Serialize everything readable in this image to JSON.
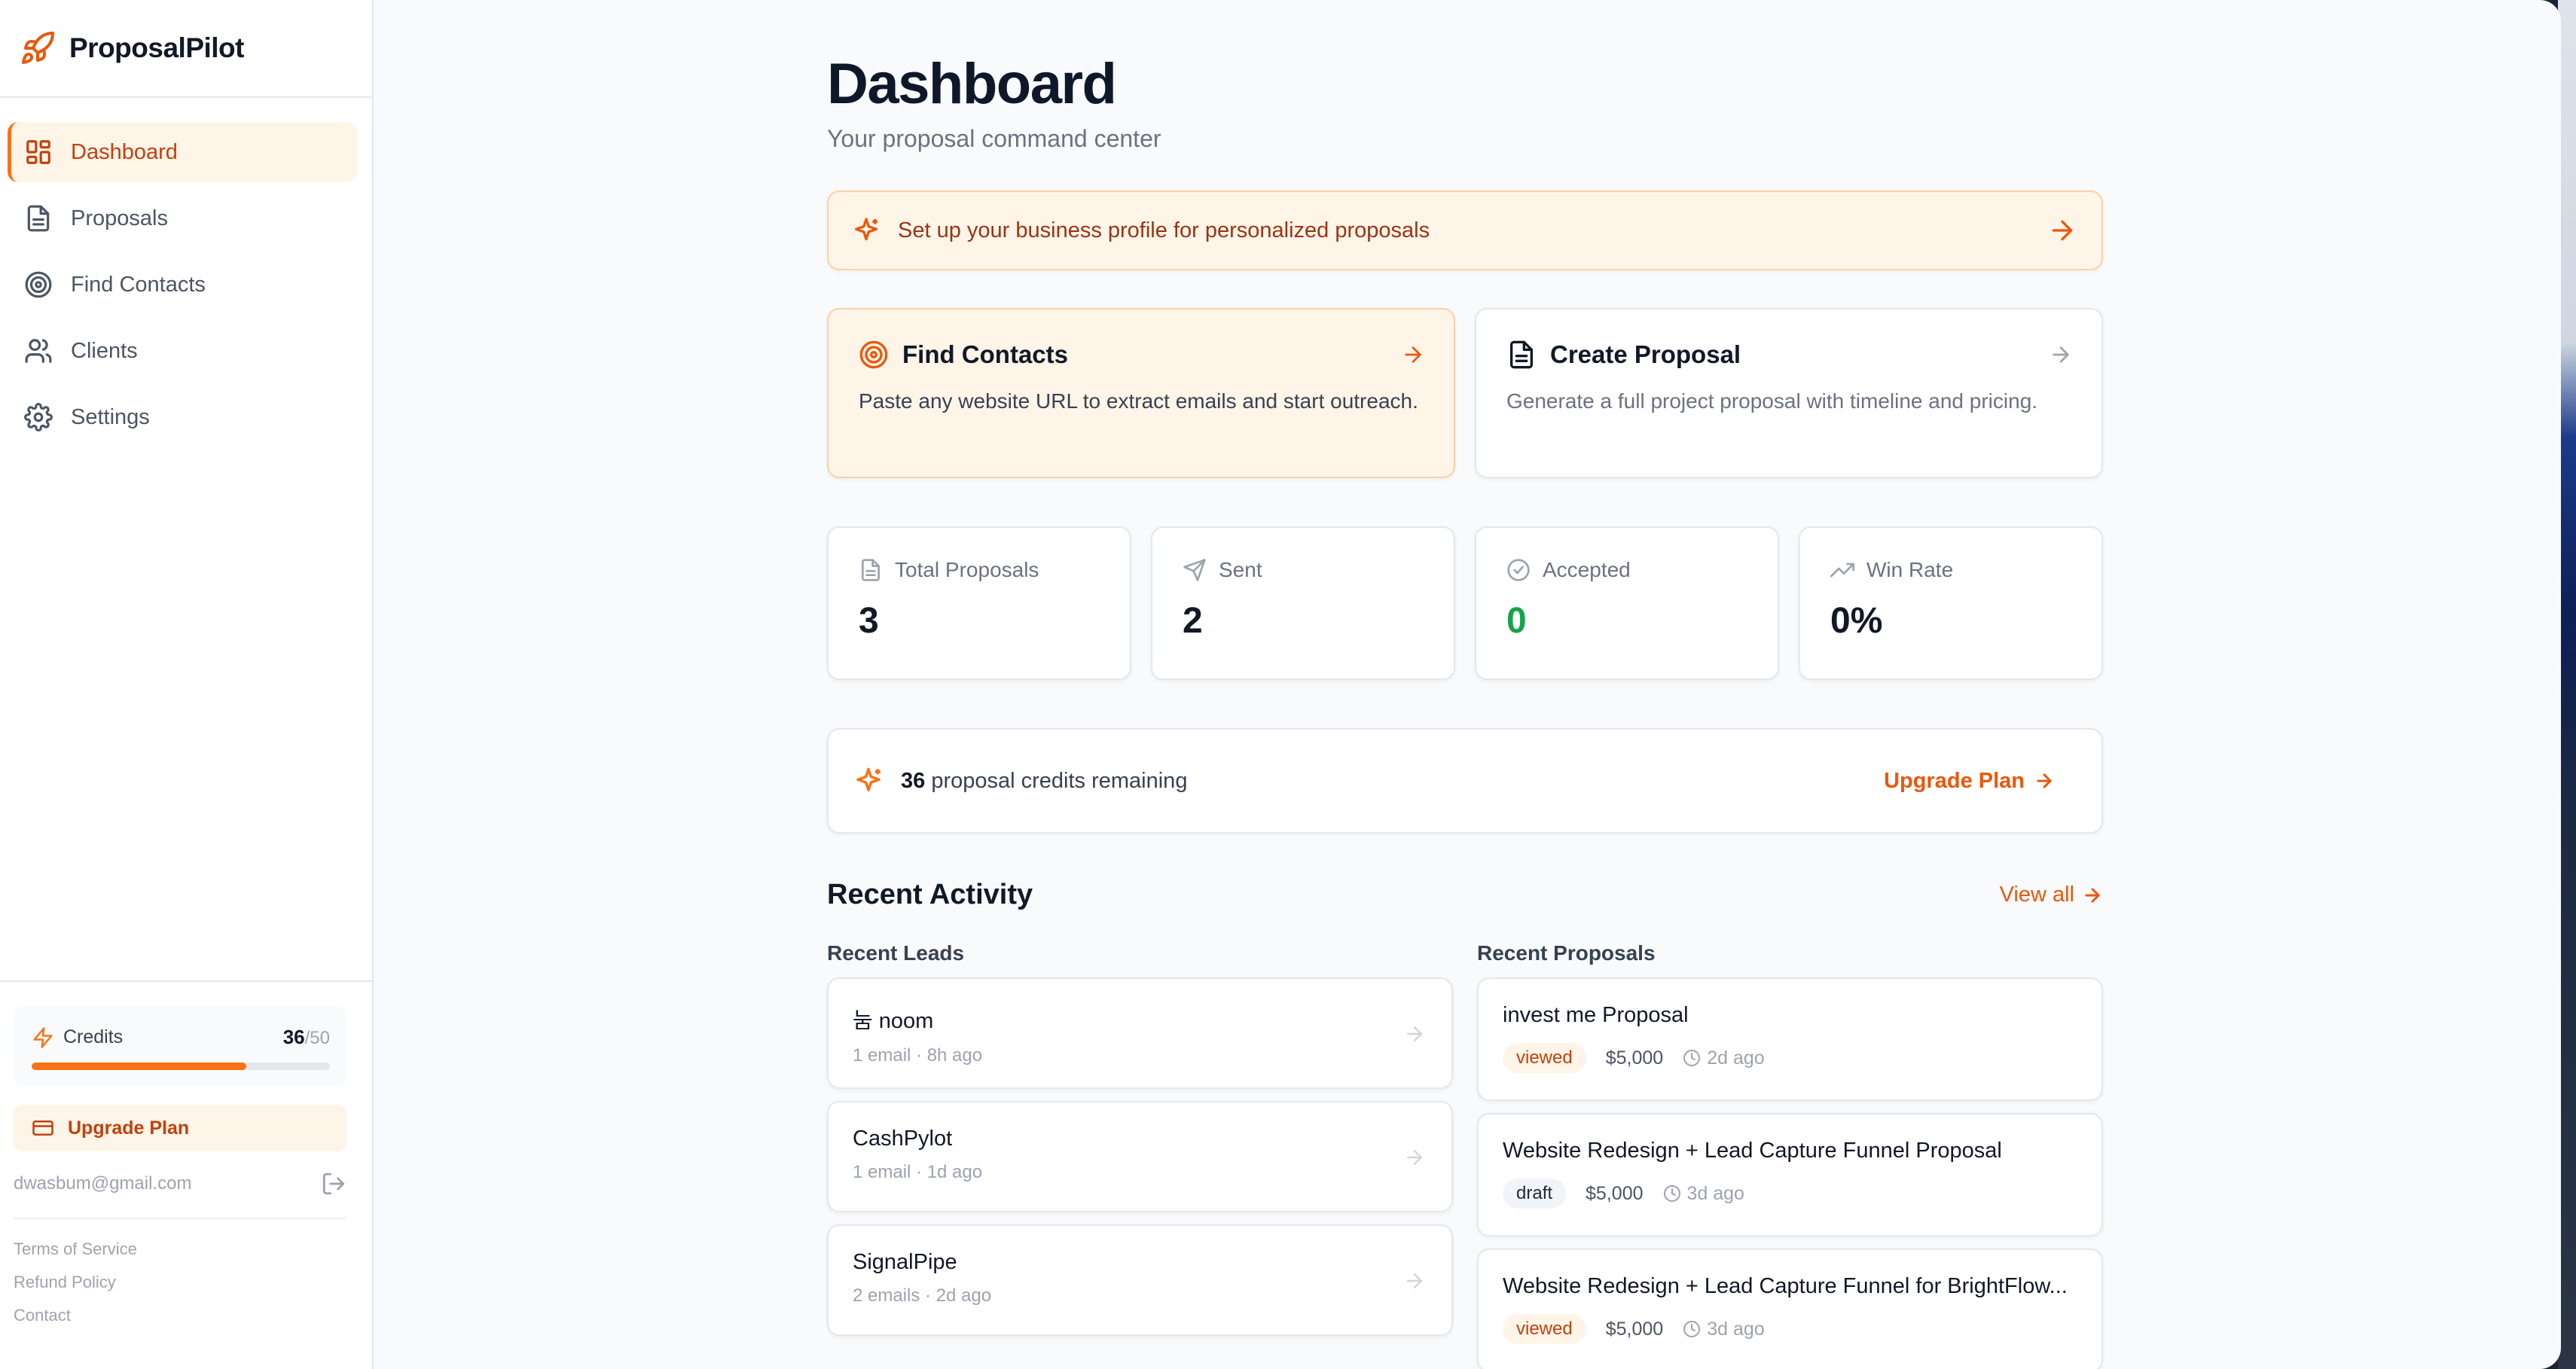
{
  "brand": {
    "name": "ProposalPilot"
  },
  "colors": {
    "accent": "#f97316",
    "accent_dark": "#c2410c",
    "success": "#16a34a"
  },
  "sidebar": {
    "items": [
      {
        "label": "Dashboard",
        "icon": "dashboard-icon",
        "active": true
      },
      {
        "label": "Proposals",
        "icon": "document-icon"
      },
      {
        "label": "Find Contacts",
        "icon": "target-icon"
      },
      {
        "label": "Clients",
        "icon": "users-icon"
      },
      {
        "label": "Settings",
        "icon": "gear-icon"
      }
    ],
    "credits_label": "Credits",
    "credits_used": "36",
    "credits_total": "/50",
    "credits_fraction": 0.72,
    "upgrade_label": "Upgrade Plan",
    "user_email": "dwasbum@gmail.com",
    "legal": [
      "Terms of Service",
      "Refund Policy",
      "Contact"
    ]
  },
  "main": {
    "title": "Dashboard",
    "subtitle": "Your proposal command center",
    "setup_banner": "Set up your business profile for personalized proposals",
    "actions": [
      {
        "title": "Find Contacts",
        "desc": "Paste any website URL to extract emails and start outreach."
      },
      {
        "title": "Create Proposal",
        "desc": "Generate a full project proposal with timeline and pricing."
      }
    ],
    "stats": [
      {
        "label": "Total Proposals",
        "value": "3"
      },
      {
        "label": "Sent",
        "value": "2"
      },
      {
        "label": "Accepted",
        "value": "0"
      },
      {
        "label": "Win Rate",
        "value": "0%"
      }
    ],
    "credits_banner": {
      "count": "36",
      "text": "proposal credits remaining",
      "upgrade": "Upgrade Plan"
    },
    "recent": {
      "title": "Recent Activity",
      "view_all": "View all",
      "leads_title": "Recent Leads",
      "leads": [
        {
          "name": "눔 noom",
          "meta": "1 email · 8h ago"
        },
        {
          "name": "CashPylot",
          "meta": "1 email · 1d ago"
        },
        {
          "name": "SignalPipe",
          "meta": "2 emails · 2d ago"
        }
      ],
      "proposals_title": "Recent Proposals",
      "proposals": [
        {
          "name": "invest me Proposal",
          "status": "viewed",
          "price": "$5,000",
          "time": "2d ago"
        },
        {
          "name": "Website Redesign + Lead Capture Funnel Proposal",
          "status": "draft",
          "price": "$5,000",
          "time": "3d ago"
        },
        {
          "name": "Website Redesign + Lead Capture Funnel for BrightFlow...",
          "status": "viewed",
          "price": "$5,000",
          "time": "3d ago"
        }
      ]
    }
  }
}
